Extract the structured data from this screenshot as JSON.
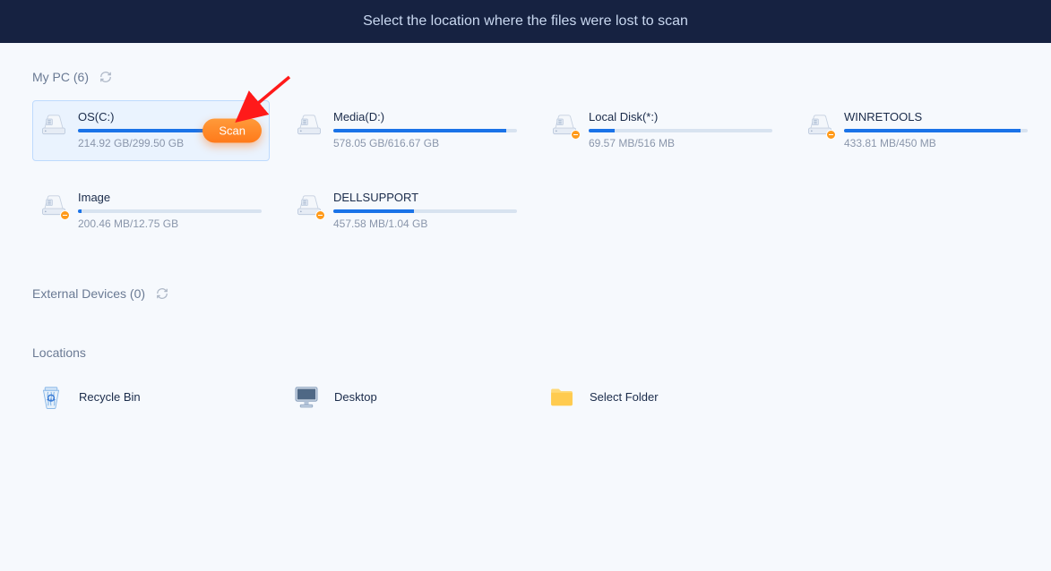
{
  "header": {
    "title": "Select the location where the files were lost to scan"
  },
  "mypc": {
    "label": "My PC (6)",
    "selected_index": 0,
    "scan_label": "Scan",
    "drives": [
      {
        "name": "OS(C:)",
        "size": "214.92 GB/299.50 GB",
        "fill_pct": 72,
        "warn": false
      },
      {
        "name": "Media(D:)",
        "size": "578.05 GB/616.67 GB",
        "fill_pct": 94,
        "warn": false
      },
      {
        "name": "Local Disk(*:)",
        "size": "69.57 MB/516 MB",
        "fill_pct": 14,
        "warn": true
      },
      {
        "name": "WINRETOOLS",
        "size": "433.81 MB/450 MB",
        "fill_pct": 96,
        "warn": true
      },
      {
        "name": "Image",
        "size": "200.46 MB/12.75 GB",
        "fill_pct": 2,
        "warn": true
      },
      {
        "name": "DELLSUPPORT",
        "size": "457.58 MB/1.04 GB",
        "fill_pct": 44,
        "warn": true
      }
    ]
  },
  "external": {
    "label": "External Devices (0)"
  },
  "locations": {
    "label": "Locations",
    "items": [
      {
        "key": "recycle",
        "label": "Recycle Bin"
      },
      {
        "key": "desktop",
        "label": "Desktop"
      },
      {
        "key": "folder",
        "label": "Select Folder"
      }
    ]
  }
}
